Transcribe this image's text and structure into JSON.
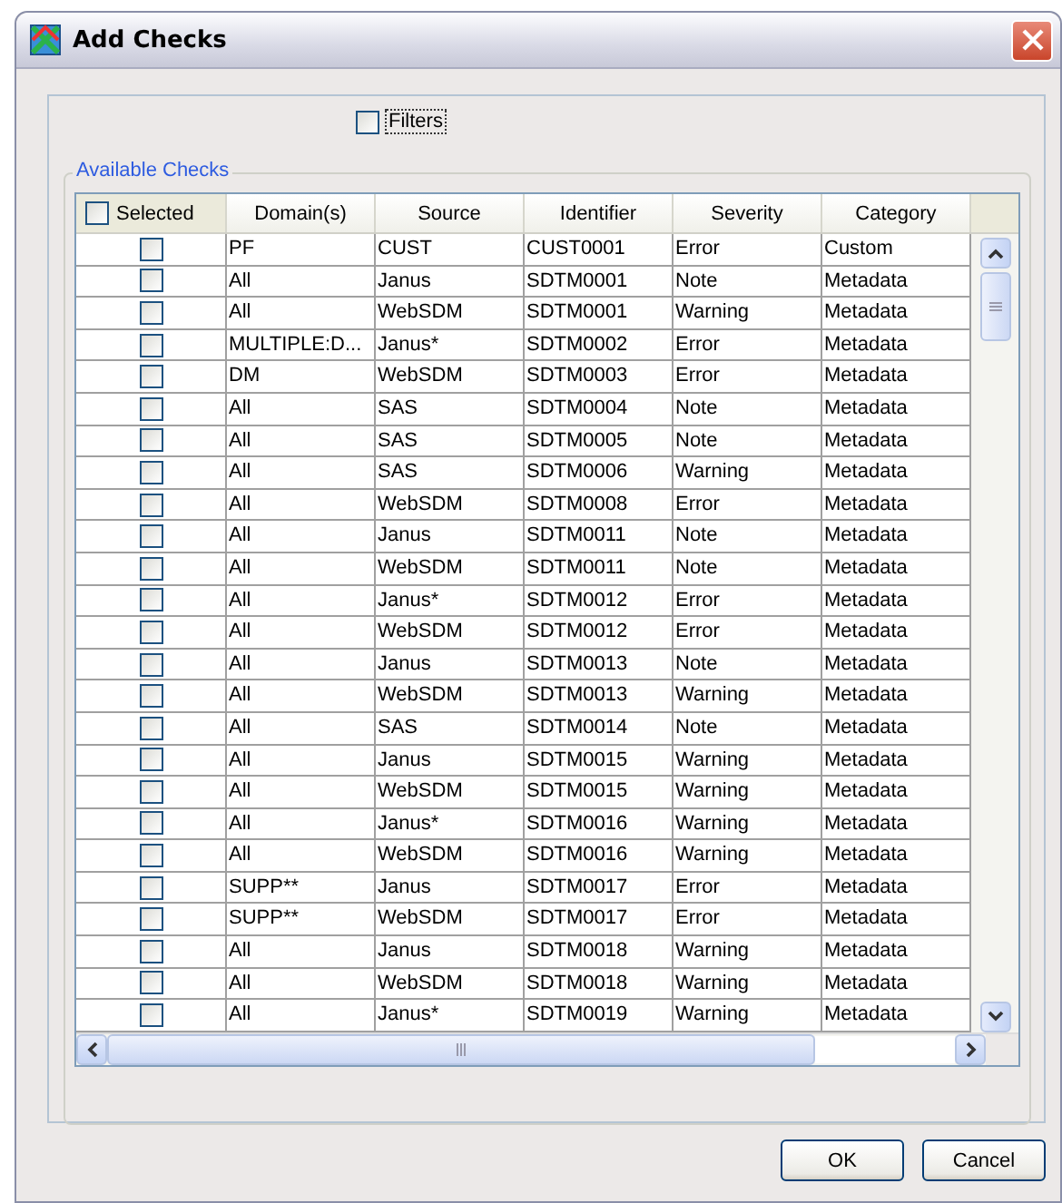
{
  "window": {
    "title": "Add Checks"
  },
  "filters": {
    "label": "Filters",
    "checked": false
  },
  "group": {
    "title": "Available Checks"
  },
  "table": {
    "select_all": {
      "label": "Selected",
      "checked": false
    },
    "columns": [
      "Domain(s)",
      "Source",
      "Identifier",
      "Severity",
      "Category"
    ],
    "rows": [
      {
        "checked": false,
        "cells": [
          "PF",
          "CUST",
          "CUST0001",
          "Error",
          "Custom"
        ]
      },
      {
        "checked": false,
        "cells": [
          "All",
          "Janus",
          "SDTM0001",
          "Note",
          "Metadata"
        ]
      },
      {
        "checked": false,
        "cells": [
          "All",
          "WebSDM",
          "SDTM0001",
          "Warning",
          "Metadata"
        ]
      },
      {
        "checked": false,
        "cells": [
          "MULTIPLE:D...",
          "Janus*",
          "SDTM0002",
          "Error",
          "Metadata"
        ]
      },
      {
        "checked": false,
        "cells": [
          "DM",
          "WebSDM",
          "SDTM0003",
          "Error",
          "Metadata"
        ]
      },
      {
        "checked": false,
        "cells": [
          "All",
          "SAS",
          "SDTM0004",
          "Note",
          "Metadata"
        ]
      },
      {
        "checked": false,
        "cells": [
          "All",
          "SAS",
          "SDTM0005",
          "Note",
          "Metadata"
        ]
      },
      {
        "checked": false,
        "cells": [
          "All",
          "SAS",
          "SDTM0006",
          "Warning",
          "Metadata"
        ]
      },
      {
        "checked": false,
        "cells": [
          "All",
          "WebSDM",
          "SDTM0008",
          "Error",
          "Metadata"
        ]
      },
      {
        "checked": false,
        "cells": [
          "All",
          "Janus",
          "SDTM0011",
          "Note",
          "Metadata"
        ]
      },
      {
        "checked": false,
        "cells": [
          "All",
          "WebSDM",
          "SDTM0011",
          "Note",
          "Metadata"
        ]
      },
      {
        "checked": false,
        "cells": [
          "All",
          "Janus*",
          "SDTM0012",
          "Error",
          "Metadata"
        ]
      },
      {
        "checked": false,
        "cells": [
          "All",
          "WebSDM",
          "SDTM0012",
          "Error",
          "Metadata"
        ]
      },
      {
        "checked": false,
        "cells": [
          "All",
          "Janus",
          "SDTM0013",
          "Note",
          "Metadata"
        ]
      },
      {
        "checked": false,
        "cells": [
          "All",
          "WebSDM",
          "SDTM0013",
          "Warning",
          "Metadata"
        ]
      },
      {
        "checked": false,
        "cells": [
          "All",
          "SAS",
          "SDTM0014",
          "Note",
          "Metadata"
        ]
      },
      {
        "checked": false,
        "cells": [
          "All",
          "Janus",
          "SDTM0015",
          "Warning",
          "Metadata"
        ]
      },
      {
        "checked": false,
        "cells": [
          "All",
          "WebSDM",
          "SDTM0015",
          "Warning",
          "Metadata"
        ]
      },
      {
        "checked": false,
        "cells": [
          "All",
          "Janus*",
          "SDTM0016",
          "Warning",
          "Metadata"
        ]
      },
      {
        "checked": false,
        "cells": [
          "All",
          "WebSDM",
          "SDTM0016",
          "Warning",
          "Metadata"
        ]
      },
      {
        "checked": false,
        "cells": [
          "SUPP**",
          "Janus",
          "SDTM0017",
          "Error",
          "Metadata"
        ]
      },
      {
        "checked": false,
        "cells": [
          "SUPP**",
          "WebSDM",
          "SDTM0017",
          "Error",
          "Metadata"
        ]
      },
      {
        "checked": false,
        "cells": [
          "All",
          "Janus",
          "SDTM0018",
          "Warning",
          "Metadata"
        ]
      },
      {
        "checked": false,
        "cells": [
          "All",
          "WebSDM",
          "SDTM0018",
          "Warning",
          "Metadata"
        ]
      },
      {
        "checked": false,
        "cells": [
          "All",
          "Janus*",
          "SDTM0019",
          "Warning",
          "Metadata"
        ]
      }
    ]
  },
  "buttons": [
    "OK",
    "Cancel"
  ]
}
